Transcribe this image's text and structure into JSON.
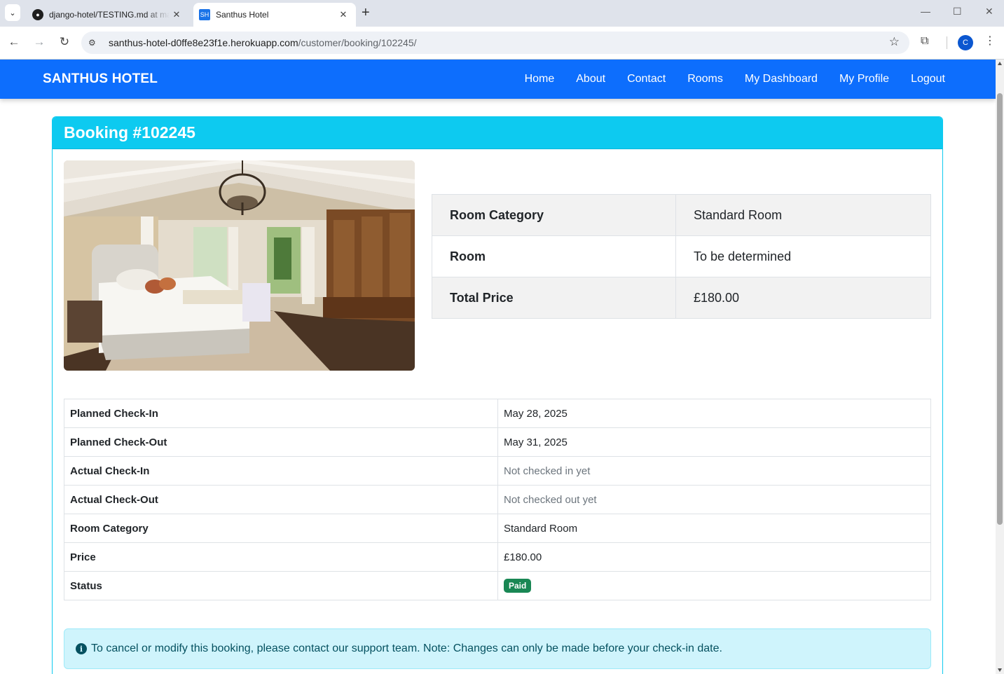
{
  "browser": {
    "tabs": [
      {
        "title": "django-hotel/TESTING.md at main",
        "favicon": "github-icon",
        "active": false
      },
      {
        "title": "Santhus Hotel",
        "favicon_text": "SH",
        "active": true
      }
    ],
    "url_host": "santhus-hotel-d0ffe8e23f1e.herokuapp.com",
    "url_path": "/customer/booking/102245/",
    "profile_initial": "C"
  },
  "nav": {
    "brand": "SANTHUS HOTEL",
    "links": [
      "Home",
      "About",
      "Contact",
      "Rooms",
      "My Dashboard",
      "My Profile",
      "Logout"
    ]
  },
  "booking": {
    "title": "Booking #102245",
    "summary": [
      {
        "label": "Room Category",
        "value": "Standard Room"
      },
      {
        "label": "Room",
        "value": "To be determined"
      },
      {
        "label": "Total Price",
        "value": "£180.00"
      }
    ],
    "details": [
      {
        "label": "Planned Check-In",
        "value": "May 28, 2025"
      },
      {
        "label": "Planned Check-Out",
        "value": "May 31, 2025"
      },
      {
        "label": "Actual Check-In",
        "value": "Not checked in yet"
      },
      {
        "label": "Actual Check-Out",
        "value": "Not checked out yet"
      },
      {
        "label": "Room Category",
        "value": "Standard Room"
      },
      {
        "label": "Price",
        "value": "£180.00"
      },
      {
        "label": "Status",
        "value": "Paid"
      }
    ],
    "notice": "To cancel or modify this booking, please contact our support team. Note: Changes can only be made before your check-in date."
  },
  "colors": {
    "navbar": "#0d6efd",
    "card_header": "#0dcaf0",
    "badge_paid": "#198754",
    "alert_bg": "#cff4fc"
  }
}
